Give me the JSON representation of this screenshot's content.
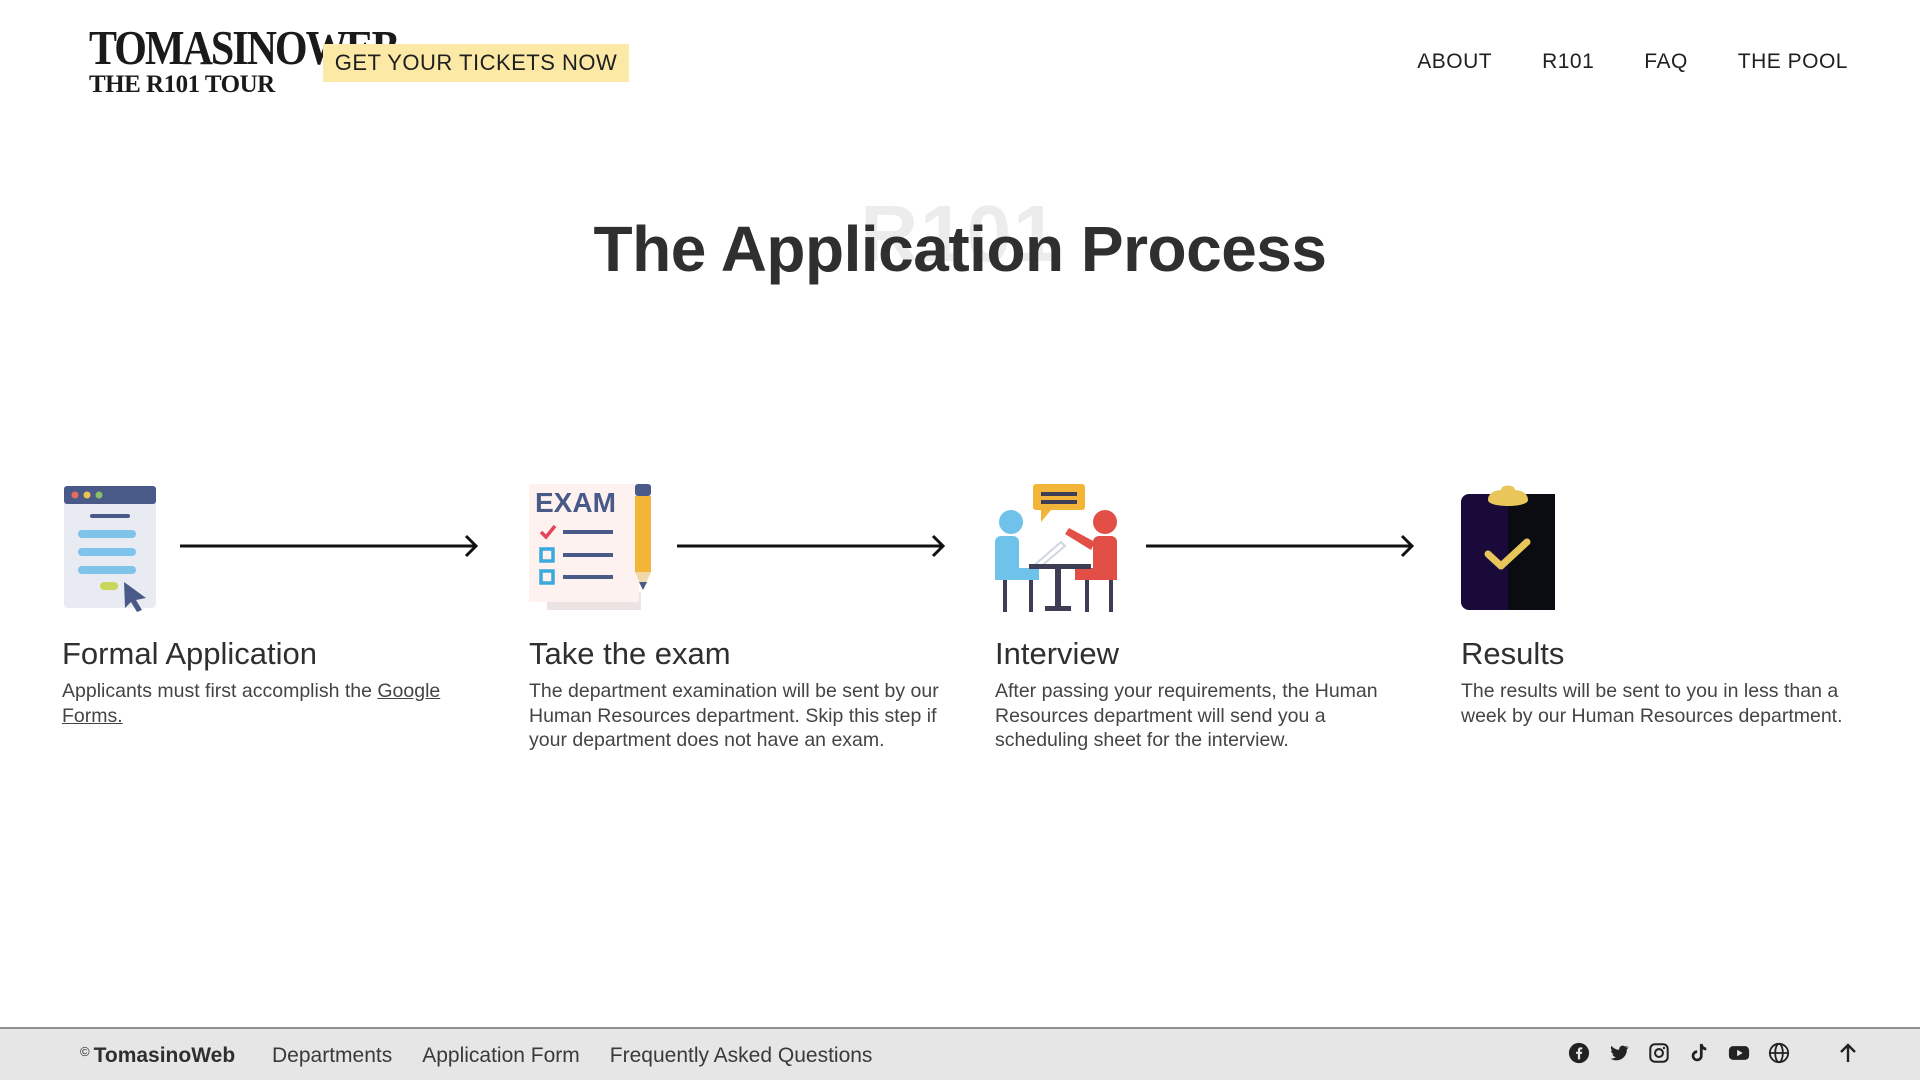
{
  "header": {
    "logo_line1": "TOMASINOWEB",
    "logo_line2": "THE R101 TOUR",
    "tickets_label": "GET YOUR TICKETS NOW",
    "nav": [
      "ABOUT",
      "R101",
      "FAQ",
      "THE POOL"
    ]
  },
  "hero": {
    "watermark": "R101",
    "title": "The Application Process"
  },
  "steps": [
    {
      "icon": "application-form-icon",
      "title": "Formal Application",
      "text": "Applicants must first accomplish the ",
      "link": "Google Forms."
    },
    {
      "icon": "exam-icon",
      "title": "Take the exam",
      "text": "The department examination will be sent by our Human Resources department. Skip this step if your department does not have an exam."
    },
    {
      "icon": "interview-icon",
      "title": "Interview",
      "text": "After passing your requirements, the Human Resources department will send you a scheduling sheet for the interview."
    },
    {
      "icon": "clipboard-check-icon",
      "title": "Results",
      "text": "The results will be sent to you in less than a week by our Human Resources department."
    }
  ],
  "footer": {
    "copyright_symbol": "©",
    "brand": "TomasinoWeb",
    "links": [
      "Departments",
      "Application Form",
      "Frequently Asked Questions"
    ],
    "social": [
      "facebook-icon",
      "twitter-icon",
      "instagram-icon",
      "tiktok-icon",
      "youtube-icon",
      "globe-icon"
    ],
    "to_top_icon": "arrow-up-icon"
  },
  "colors": {
    "ticket_bg": "#fde9a6",
    "text_dark": "#2f2f2f",
    "footer_bg": "#e6e6e6"
  }
}
